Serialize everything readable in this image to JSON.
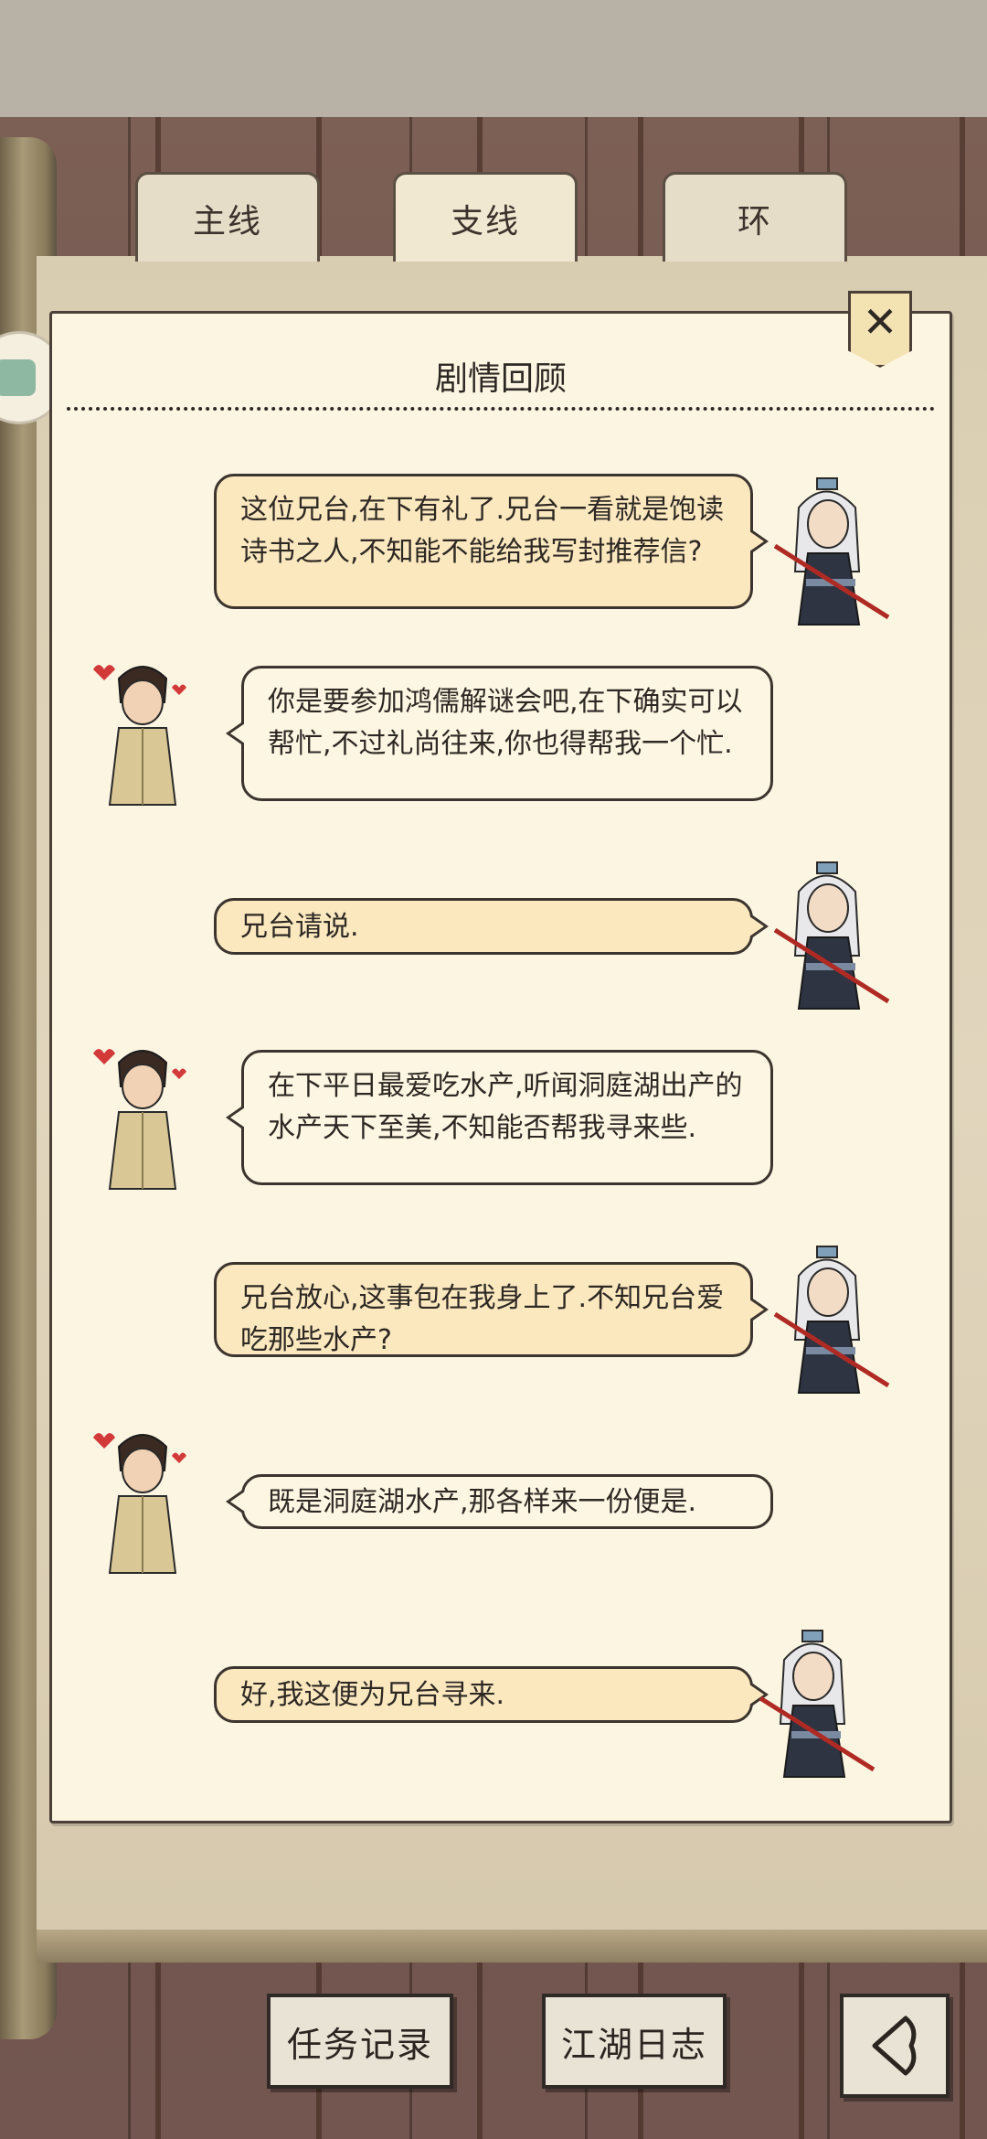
{
  "tabs": [
    {
      "label": "主线"
    },
    {
      "label": "支线"
    },
    {
      "label": "环"
    }
  ],
  "panel": {
    "title": "剧情回顾",
    "close_symbol": "✕"
  },
  "dialogue": [
    {
      "speaker": "swordsman",
      "side": "right",
      "text": "这位兄台,在下有礼了.兄台一看就是饱读诗书之人,不知能不能给我写封推荐信?"
    },
    {
      "speaker": "scholar",
      "side": "left",
      "text": "你是要参加鸿儒解谜会吧,在下确实可以帮忙,不过礼尚往来,你也得帮我一个忙."
    },
    {
      "speaker": "swordsman",
      "side": "right",
      "text": "兄台请说."
    },
    {
      "speaker": "scholar",
      "side": "left",
      "text": "在下平日最爱吃水产,听闻洞庭湖出产的水产天下至美,不知能否帮我寻来些."
    },
    {
      "speaker": "swordsman",
      "side": "right",
      "text": "兄台放心,这事包在我身上了.不知兄台爱吃那些水产?"
    },
    {
      "speaker": "scholar",
      "side": "left",
      "text": "既是洞庭湖水产,那各样来一份便是."
    },
    {
      "speaker": "swordsman",
      "side": "right",
      "text": "好,我这便为兄台寻来."
    }
  ],
  "bottom_buttons": {
    "tasks": "任务记录",
    "journal": "江湖日志",
    "back_icon": "back-arrow-icon"
  },
  "colors": {
    "panel_bg": "#fcf5e2",
    "bubble_right": "#fbe8bf",
    "bubble_left": "#fdf6e2",
    "ink": "#2d2824"
  }
}
